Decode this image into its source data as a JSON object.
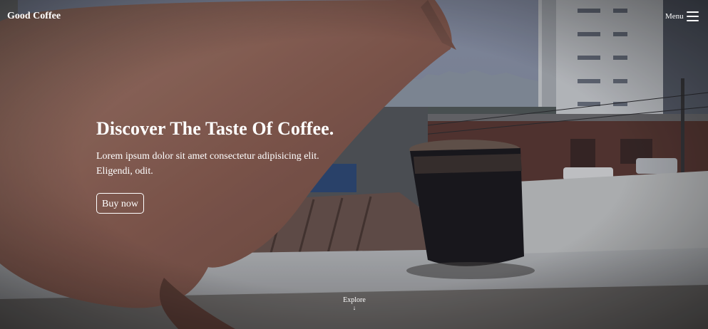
{
  "nav": {
    "brand": "Good Coffee",
    "menu_label": "Menu",
    "menu_icon": "hamburger-menu-icon"
  },
  "hero": {
    "headline": "Discover The Taste Of Coffee.",
    "lead": "Lorem ipsum dolor sit amet consectetur adipisicing elit. Eligendi, odit.",
    "button_label": "Buy now",
    "explore_label": "Explore",
    "explore_icon": "arrow-down-icon",
    "accent": "#ffffff"
  }
}
